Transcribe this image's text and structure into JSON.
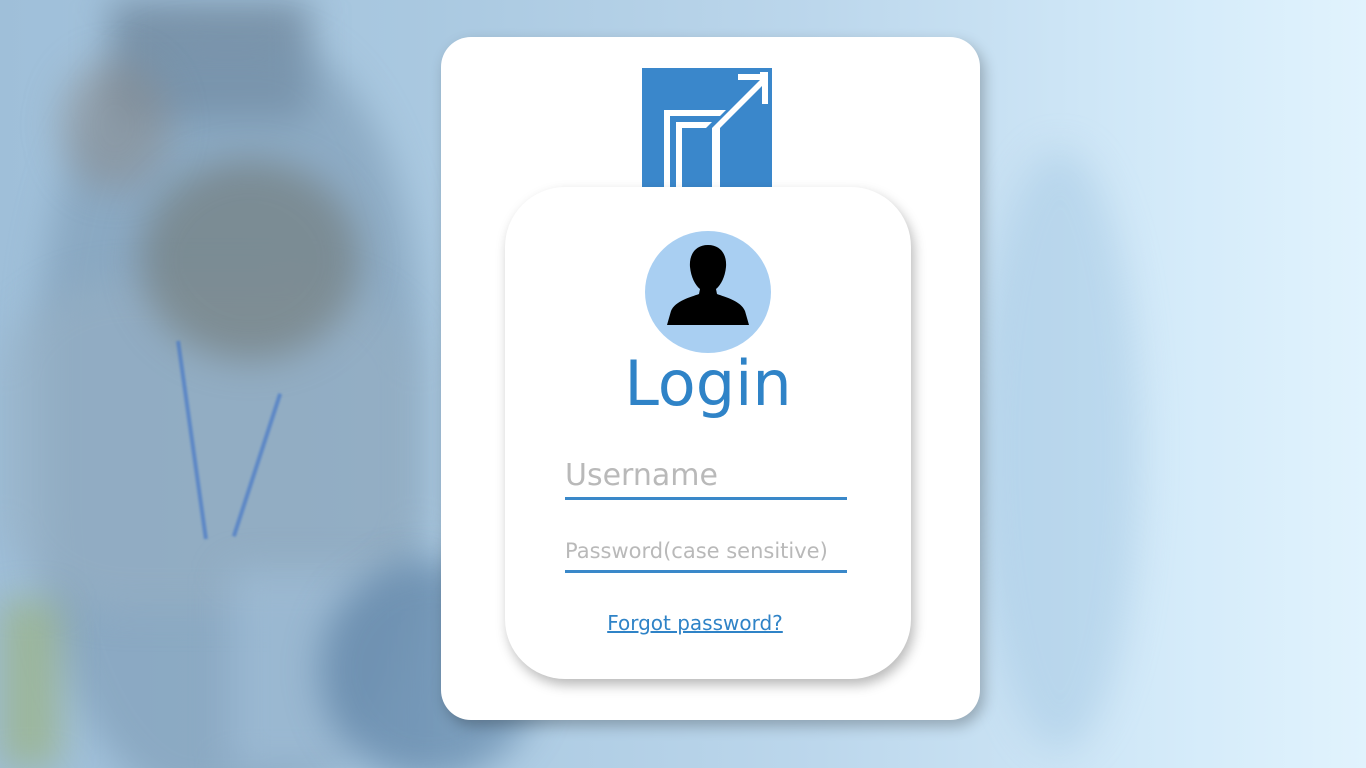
{
  "login": {
    "title": "Login",
    "username_placeholder": "Username",
    "password_placeholder": "Password(case sensitive)",
    "forgot_link": "Forgot password?"
  },
  "icons": {
    "logo": "brand-logo-icon",
    "avatar": "user-silhouette-icon"
  },
  "colors": {
    "accent": "#2f83c7",
    "logo_blue": "#3a87cb",
    "avatar_bg": "#a9cff2"
  }
}
